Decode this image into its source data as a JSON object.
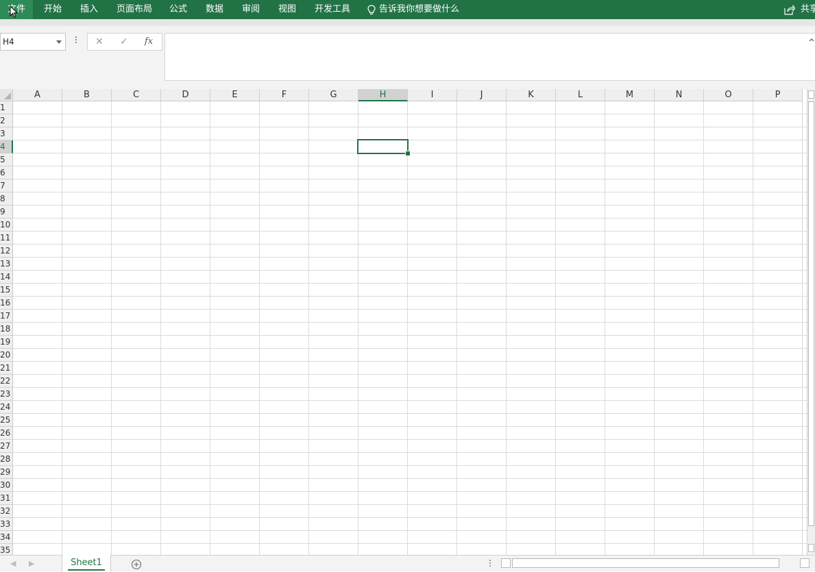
{
  "ribbon": {
    "tabs": [
      "文件",
      "开始",
      "插入",
      "页面布局",
      "公式",
      "数据",
      "审阅",
      "视图",
      "开发工具"
    ],
    "tell_me": "告诉我你想要做什么",
    "share": "共享",
    "accent_color": "#217346"
  },
  "formula_bar": {
    "name_box": "H4",
    "cancel_icon": "✕",
    "enter_icon": "✓",
    "fx_label": "fx",
    "formula_value": ""
  },
  "grid": {
    "columns": [
      "A",
      "B",
      "C",
      "D",
      "E",
      "F",
      "G",
      "H",
      "I",
      "J",
      "K",
      "L",
      "M",
      "N",
      "O",
      "P"
    ],
    "rows": [
      "1",
      "2",
      "3",
      "4",
      "5",
      "6",
      "7",
      "8",
      "9",
      "10",
      "11",
      "12",
      "13",
      "14",
      "15",
      "16",
      "17",
      "18",
      "19",
      "20",
      "21",
      "22",
      "23",
      "24",
      "25",
      "26",
      "27",
      "28",
      "29",
      "30",
      "31",
      "32",
      "33",
      "34",
      "35"
    ],
    "selected_column": "H",
    "selected_row": "4"
  },
  "sheets": {
    "tabs": [
      "Sheet1"
    ],
    "active": "Sheet1"
  }
}
